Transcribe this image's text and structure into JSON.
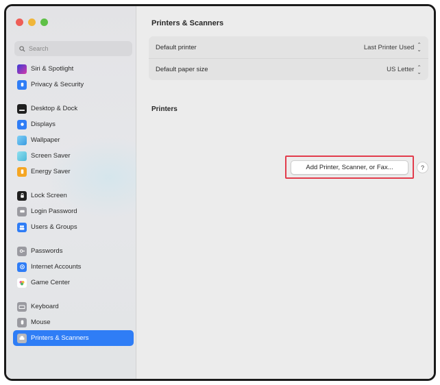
{
  "window": {
    "title": "Printers & Scanners"
  },
  "search": {
    "placeholder": "Search"
  },
  "sidebar": {
    "items": [
      {
        "label": "Siri & Spotlight",
        "icon": "siri-icon",
        "color": "#5b4bd6"
      },
      {
        "label": "Privacy & Security",
        "icon": "hand-icon",
        "color": "#2f7df6"
      },
      {
        "label": "Desktop & Dock",
        "icon": "dock-icon",
        "color": "#1f1f1f"
      },
      {
        "label": "Displays",
        "icon": "sun-icon",
        "color": "#2f7df6"
      },
      {
        "label": "Wallpaper",
        "icon": "flower-icon",
        "color": "#4fb3e8"
      },
      {
        "label": "Screen Saver",
        "icon": "screen-saver-icon",
        "color": "#5fc7e8"
      },
      {
        "label": "Energy Saver",
        "icon": "battery-icon",
        "color": "#f5a623"
      },
      {
        "label": "Lock Screen",
        "icon": "lock-icon",
        "color": "#1f1f1f"
      },
      {
        "label": "Login Password",
        "icon": "key-icon",
        "color": "#8e8e93"
      },
      {
        "label": "Users & Groups",
        "icon": "users-icon",
        "color": "#2f7df6"
      },
      {
        "label": "Passwords",
        "icon": "password-key-icon",
        "color": "#8e8e93"
      },
      {
        "label": "Internet Accounts",
        "icon": "at-icon",
        "color": "#2f7df6"
      },
      {
        "label": "Game Center",
        "icon": "game-center-icon",
        "color": "#ffffff"
      },
      {
        "label": "Keyboard",
        "icon": "keyboard-icon",
        "color": "#8e8e93"
      },
      {
        "label": "Mouse",
        "icon": "mouse-icon",
        "color": "#8e8e93"
      },
      {
        "label": "Printers & Scanners",
        "icon": "printer-icon",
        "color": "#8e8e93"
      }
    ],
    "selected": "Printers & Scanners"
  },
  "settings": {
    "default_printer_label": "Default printer",
    "default_printer_value": "Last Printer Used",
    "default_paper_label": "Default paper size",
    "default_paper_value": "US Letter"
  },
  "printers": {
    "heading": "Printers",
    "add_button_label": "Add Printer, Scanner, or Fax...",
    "help_label": "?"
  },
  "colors": {
    "accent": "#2f7df6",
    "highlight_box": "#e23b4b"
  }
}
